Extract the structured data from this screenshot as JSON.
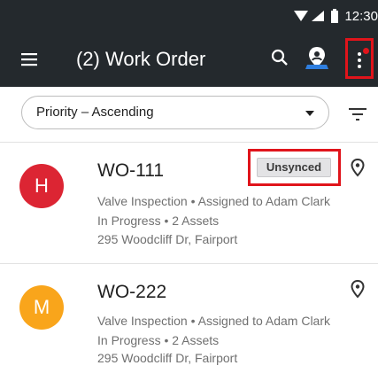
{
  "status_bar": {
    "time": "12:30",
    "icons": [
      "wifi-icon",
      "signal-icon",
      "battery-icon"
    ]
  },
  "app_bar": {
    "title": "(2) Work Order",
    "icons": [
      "menu-icon",
      "search-icon",
      "map-pin-person-icon",
      "more-vert-icon"
    ],
    "has_notification_badge": true
  },
  "sort": {
    "selected": "Priority – Ascending",
    "icons": [
      "chevron-down-icon",
      "filter-icon"
    ]
  },
  "work_orders": [
    {
      "avatar_letter": "H",
      "avatar_color": "#dc2533",
      "id": "WO-111",
      "badge": "Unsynced",
      "line1": "Valve Inspection • Assigned to Adam Clark",
      "line2": "In Progress • 2 Assets",
      "line3": "295 Woodcliff Dr, Fairport"
    },
    {
      "avatar_letter": "M",
      "avatar_color": "#f9a51b",
      "id": "WO-222",
      "badge": "",
      "line1": "Valve Inspection • Assigned to Adam Clark",
      "line2": "In Progress • 2 Assets",
      "line3": "295 Woodcliff Dr, Fairport"
    }
  ],
  "colors": {
    "app_bar_bg": "#24292d",
    "highlight": "#e0141b",
    "badge_bg": "#e3e3e5"
  }
}
